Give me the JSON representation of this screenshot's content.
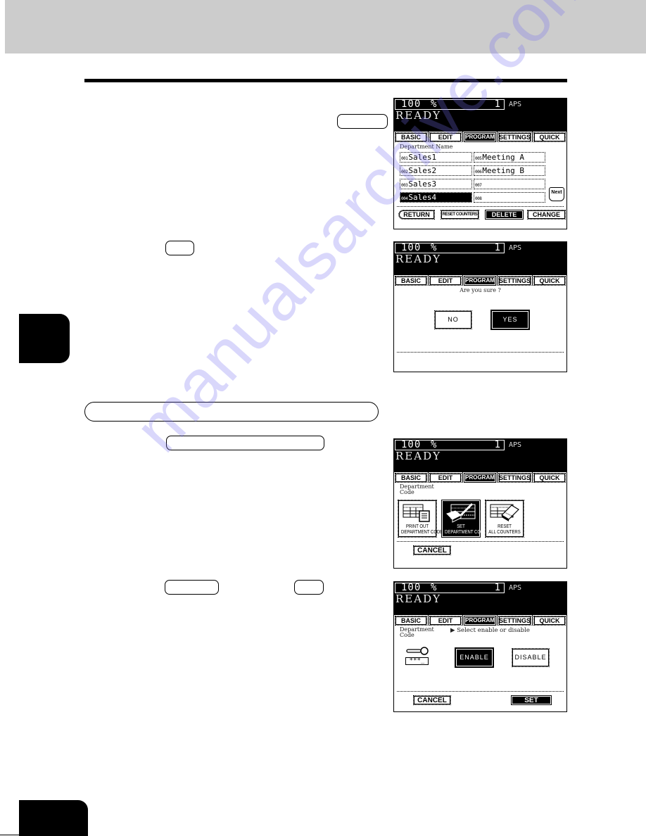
{
  "page": {
    "colors": {
      "header_band": "#cccccc",
      "ink": "#000000",
      "watermark": "#8c82f0"
    },
    "watermark_text": "manualsarchive.com"
  },
  "panel_common": {
    "zoom": "100",
    "zoom_unit": "%",
    "copies": "1",
    "paper": "APS",
    "status": "READY",
    "tabs": [
      {
        "label": "BASIC",
        "active": false
      },
      {
        "label": "EDIT",
        "active": false
      },
      {
        "label": "PROGRAM",
        "active": true
      },
      {
        "label": "SETTINGS",
        "active": false
      },
      {
        "label": "QUICK",
        "active": false
      }
    ]
  },
  "panel1": {
    "heading": "Department Name",
    "entries": [
      {
        "num": "001",
        "name": "Sales1",
        "selected": false
      },
      {
        "num": "002",
        "name": "Sales2",
        "selected": false
      },
      {
        "num": "003",
        "name": "Sales3",
        "selected": false
      },
      {
        "num": "004",
        "name": "Sales4",
        "selected": true
      },
      {
        "num": "005",
        "name": "Meeting A",
        "selected": false
      },
      {
        "num": "006",
        "name": "Meeting B",
        "selected": false
      },
      {
        "num": "007",
        "name": "",
        "selected": false
      },
      {
        "num": "008",
        "name": "",
        "selected": false
      }
    ],
    "next_label": "Next",
    "buttons": {
      "return": "RETURN",
      "reset_counters": "RESET COUNTERS",
      "delete": "DELETE",
      "change": "CHANGE"
    }
  },
  "panel2": {
    "question": "Are you sure ?",
    "no_label": "NO",
    "yes_label": "YES"
  },
  "panel3": {
    "heading_line1": "Department",
    "heading_line2": "Code",
    "options": [
      {
        "line1": "PRINT OUT",
        "line2": "DEPARTMENT CODES",
        "selected": false
      },
      {
        "line1": "SET",
        "line2": "DEPARTMENT CODES",
        "selected": true
      },
      {
        "line1": "RESET",
        "line2": "ALL COUNTERS",
        "selected": false
      }
    ],
    "cancel_label": "CANCEL"
  },
  "panel4": {
    "heading_line1": "Department",
    "heading_line2": "Code",
    "instruction": "▶ Select enable or disable",
    "code_mask": "***_",
    "enable_label": "ENABLE",
    "disable_label": "DISABLE",
    "cancel_label": "CANCEL",
    "set_label": "SET"
  }
}
